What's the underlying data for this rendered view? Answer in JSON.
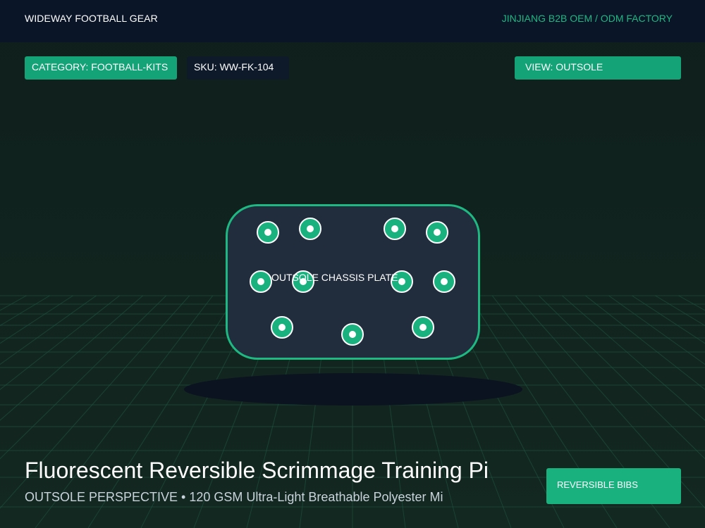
{
  "header": {
    "brand": "WIDEWAY FOOTBALL GEAR",
    "factory": "JINJIANG B2B OEM / ODM FACTORY"
  },
  "chips": {
    "category": "CATEGORY: FOOTBALL-KITS",
    "sku": "SKU: WW-FK-104",
    "view": "VIEW: OUTSOLE"
  },
  "viewer": {
    "plate_label": "OUTSOLE CHASSIS PLATE",
    "stud_count": 11
  },
  "product": {
    "title": "Fluorescent Reversible Scrimmage Training Pi",
    "subtitle": "OUTSOLE PERSPECTIVE • 120 GSM Ultra-Light Breathable Polyester Mi",
    "tag": "REVERSIBLE BIBS"
  },
  "colors": {
    "accent": "#19b27e",
    "header_bg": "#0b1528",
    "plate_bg": "#212c3c",
    "page_bg": "#132820"
  }
}
